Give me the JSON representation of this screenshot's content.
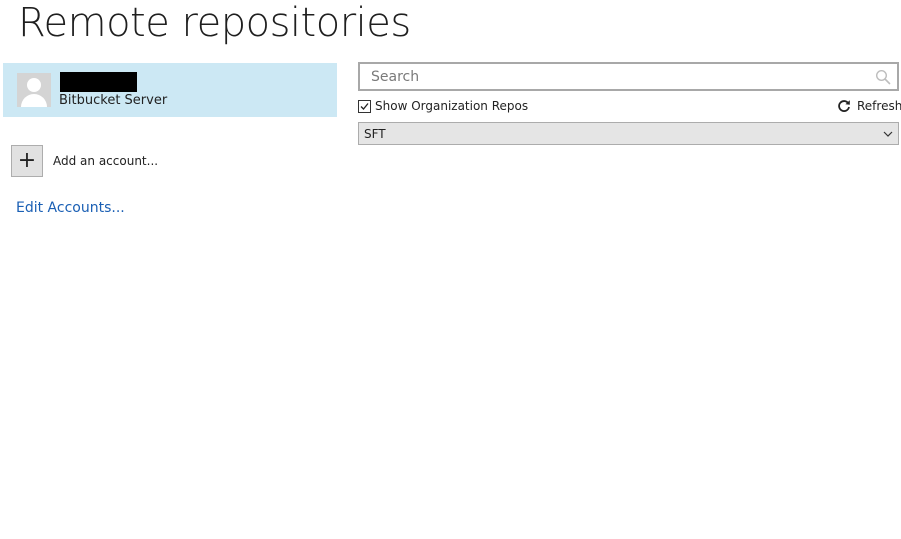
{
  "page": {
    "title": "Remote repositories"
  },
  "accounts": {
    "items": [
      {
        "name_redacted": true,
        "type": "Bitbucket Server",
        "selected": true
      }
    ],
    "add_label": "Add an account...",
    "add_symbol": "+",
    "edit_label": "Edit Accounts..."
  },
  "repos": {
    "search_placeholder": "Search",
    "show_org_label": "Show Organization Repos",
    "show_org_checked": true,
    "refresh_label": "Refresh",
    "selected_org": "SFT"
  },
  "colors": {
    "selected_bg": "#cce8f4",
    "link": "#1a5fb4"
  }
}
